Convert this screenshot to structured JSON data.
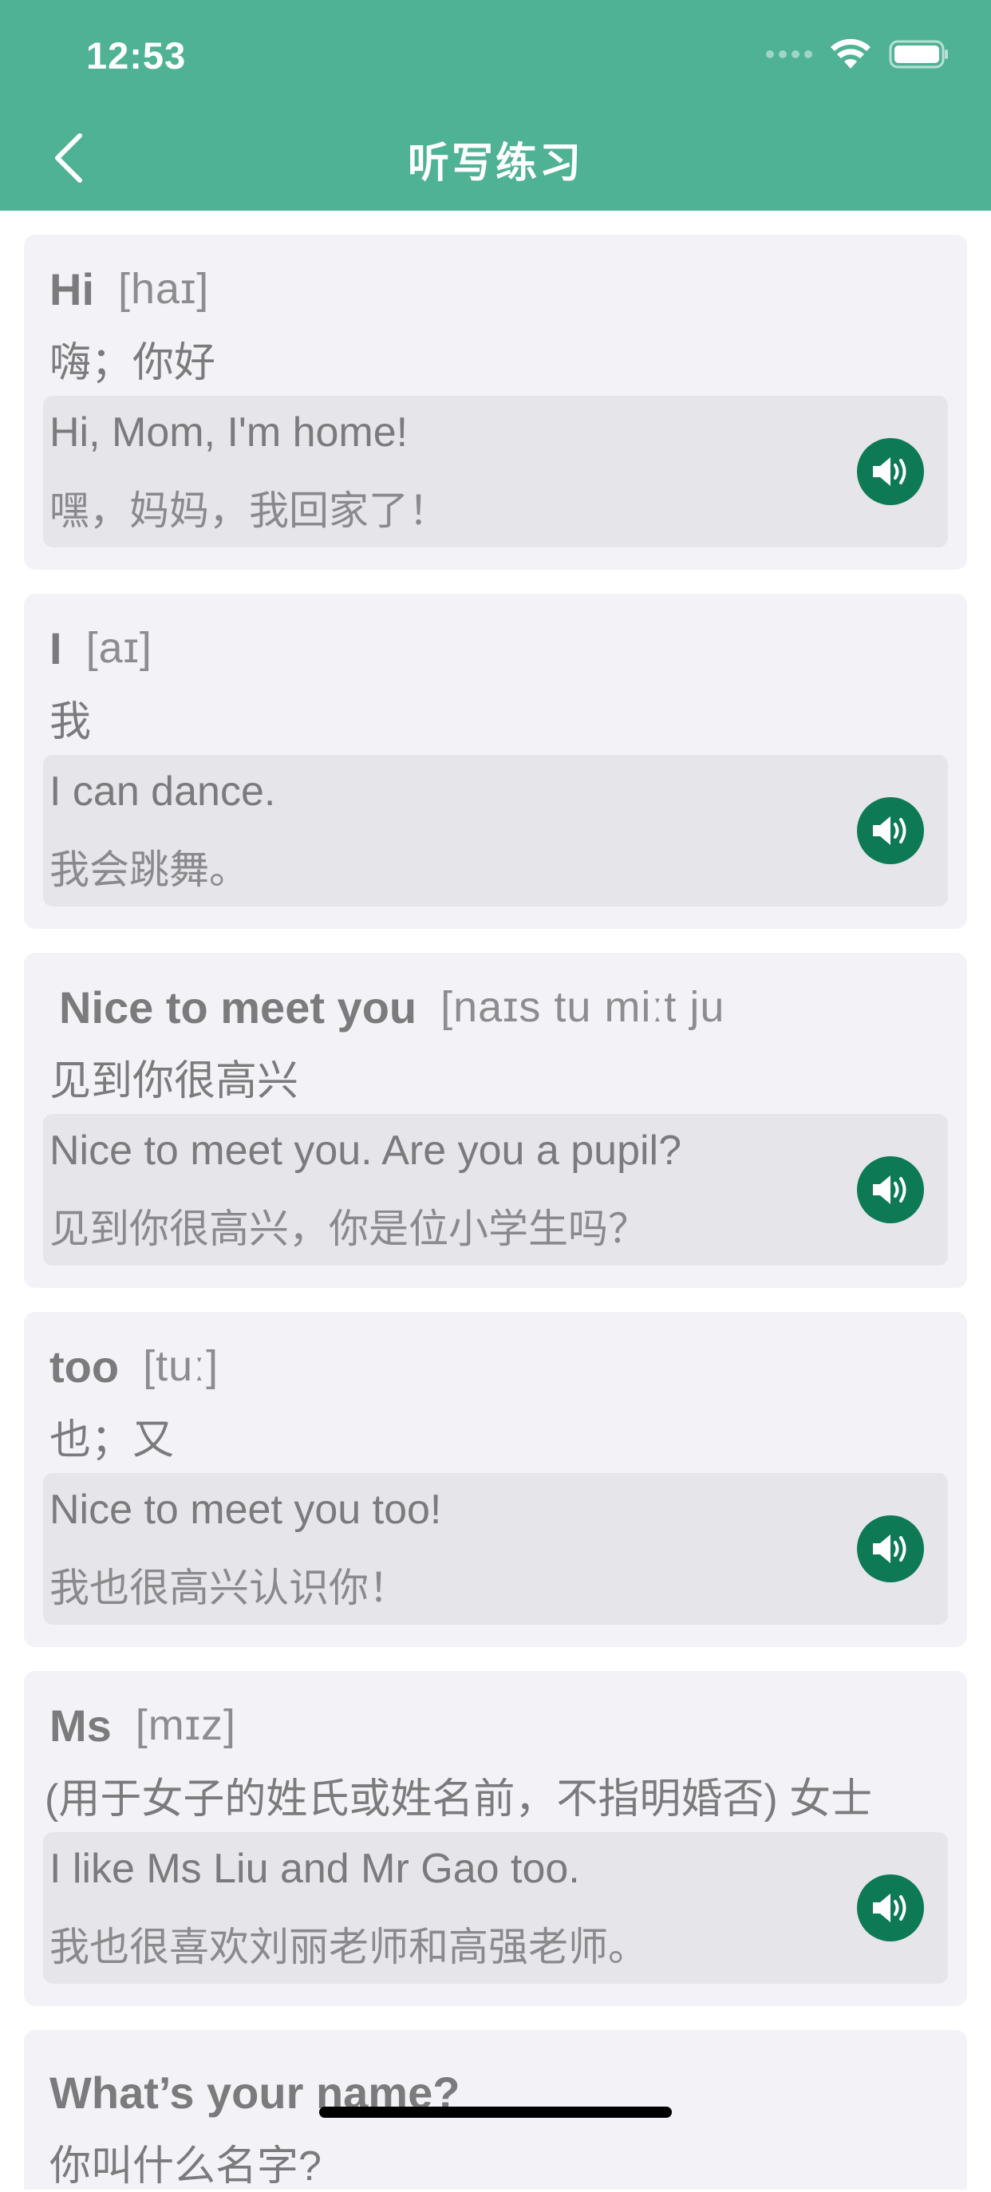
{
  "status_bar": {
    "time": "12:53"
  },
  "nav": {
    "title": "听写练习",
    "back_icon": "chevron-left-icon"
  },
  "colors": {
    "header_bg": "#4fb295",
    "card_bg": "#f3f3f7",
    "example_bg": "#e5e5ea",
    "speaker_button": "#0e7a55"
  },
  "cards": [
    {
      "word": "Hi",
      "phonetic": "[haɪ]",
      "meaning": "嗨；你好",
      "example_en": "Hi, Mom, I'm home!",
      "example_zh": "嘿，妈妈，我回家了！",
      "speaker_icon": "speaker-icon"
    },
    {
      "word": "I",
      "phonetic": "[aɪ]",
      "meaning": "我",
      "example_en": "I can dance.",
      "example_zh": "我会跳舞。",
      "speaker_icon": "speaker-icon"
    },
    {
      "word": "Nice to meet you",
      "phonetic": "[naɪs tu miːt ju",
      "meaning": "见到你很高兴",
      "example_en": "Nice to meet you. Are you a pupil?",
      "example_zh": "见到你很高兴，你是位小学生吗？",
      "speaker_icon": "speaker-icon"
    },
    {
      "word": "too",
      "phonetic": "[tuː]",
      "meaning": "也；又",
      "example_en": "Nice to meet you too!",
      "example_zh": "我也很高兴认识你！",
      "speaker_icon": "speaker-icon"
    },
    {
      "word": "Ms",
      "phonetic": "[mɪz]",
      "meaning": "(用于女子的姓氏或姓名前，不指明婚否) 女士",
      "example_en": "I like Ms Liu and Mr Gao too.",
      "example_zh": "我也很喜欢刘丽老师和高强老师。",
      "speaker_icon": "speaker-icon"
    }
  ],
  "partial_card": {
    "word": "What’s your name?",
    "meaning": "你叫什么名字?"
  }
}
